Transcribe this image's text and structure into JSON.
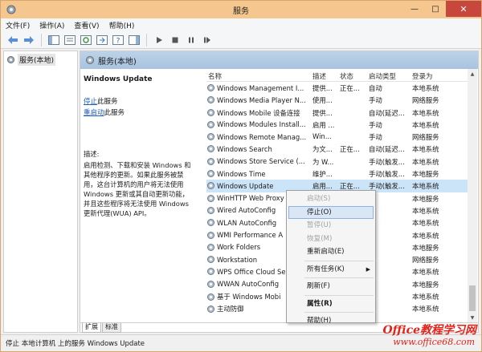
{
  "window": {
    "title": "服务"
  },
  "menu": [
    "文件(F)",
    "操作(A)",
    "查看(V)",
    "帮助(H)"
  ],
  "tree": {
    "root_label": "服务(本地)"
  },
  "main": {
    "header_label": "服务(本地)"
  },
  "description_pane": {
    "service_name": "Windows Update",
    "stop_link": "停止",
    "stop_suffix": "此服务",
    "restart_link": "重启动",
    "restart_suffix": "此服务",
    "desc_label": "描述:",
    "desc_lines": [
      "启用检测、下载和安装 Windows 和",
      "其他程序的更新。如果此服务被禁",
      "用，这台计算机的用户将无法使用",
      "Windows 更新或其自动更新功能，",
      "并且这些程序将无法使用 Windows",
      "更新代理(WUA) API。"
    ]
  },
  "table": {
    "columns": [
      "名称",
      "描述",
      "状态",
      "启动类型",
      "登录为"
    ],
    "rows": [
      {
        "name": "Windows Management I...",
        "desc": "提供...",
        "status": "正在...",
        "start": "自动",
        "logon": "本地系统"
      },
      {
        "name": "Windows Media Player N...",
        "desc": "使用...",
        "status": "",
        "start": "手动",
        "logon": "网络服务"
      },
      {
        "name": "Windows Mobile 设备连接",
        "desc": "提供...",
        "status": "",
        "start": "自动(延迟...",
        "logon": "本地系统"
      },
      {
        "name": "Windows Modules Install...",
        "desc": "启用 ...",
        "status": "",
        "start": "手动",
        "logon": "本地系统"
      },
      {
        "name": "Windows Remote Manag...",
        "desc": "Win...",
        "status": "",
        "start": "手动",
        "logon": "网络服务"
      },
      {
        "name": "Windows Search",
        "desc": "为文...",
        "status": "正在...",
        "start": "自动(延迟...",
        "logon": "本地系统"
      },
      {
        "name": "Windows Store Service (...",
        "desc": "为 W...",
        "status": "",
        "start": "手动(触发...",
        "logon": "本地系统"
      },
      {
        "name": "Windows Time",
        "desc": "维护...",
        "status": "",
        "start": "手动(触发...",
        "logon": "本地服务"
      },
      {
        "name": "Windows Update",
        "desc": "启用...",
        "status": "正在...",
        "start": "手动(触发...",
        "logon": "本地系统",
        "selected": true
      },
      {
        "name": "WinHTTP Web Proxy",
        "desc": "",
        "status": "",
        "start": "",
        "logon": "本地服务"
      },
      {
        "name": "Wired AutoConfig",
        "desc": "",
        "status": "",
        "start": "",
        "logon": "本地系统"
      },
      {
        "name": "WLAN AutoConfig",
        "desc": "",
        "status": "",
        "start": "",
        "logon": "本地系统"
      },
      {
        "name": "WMI Performance A",
        "desc": "",
        "status": "",
        "start": "",
        "logon": "本地系统"
      },
      {
        "name": "Work Folders",
        "desc": "",
        "status": "",
        "start": "",
        "logon": "本地服务"
      },
      {
        "name": "Workstation",
        "desc": "",
        "status": "",
        "start": "",
        "logon": "网络服务"
      },
      {
        "name": "WPS Office Cloud Se",
        "desc": "",
        "status": "",
        "start": "",
        "logon": "本地系统"
      },
      {
        "name": "WWAN AutoConfig",
        "desc": "",
        "status": "",
        "start": "",
        "logon": "本地服务"
      },
      {
        "name": "基于 Windows Mobi",
        "desc": "",
        "status": "",
        "start": "",
        "logon": "本地系统"
      },
      {
        "name": "主动防御",
        "desc": "",
        "status": "",
        "start": "",
        "logon": "本地系统"
      }
    ]
  },
  "context_menu": {
    "start": "启动(S)",
    "stop": "停止(O)",
    "pause": "暂停(U)",
    "resume": "恢复(M)",
    "restart": "重新启动(E)",
    "all_tasks": "所有任务(K)",
    "refresh": "刷新(F)",
    "properties": "属性(R)",
    "help": "帮助(H)"
  },
  "tabs": [
    "扩展",
    "标准"
  ],
  "statusbar": {
    "text": "停止 本地计算机 上的服务 Windows Update"
  },
  "watermark": {
    "line1": "Office教程学习网",
    "line2": "www.office68.com"
  },
  "colors": {
    "titlebar": "#f6c68f",
    "header": "#b3cbe4",
    "selected_row": "#cce4f7",
    "close": "#c7473c",
    "link": "#1c5ebd"
  }
}
